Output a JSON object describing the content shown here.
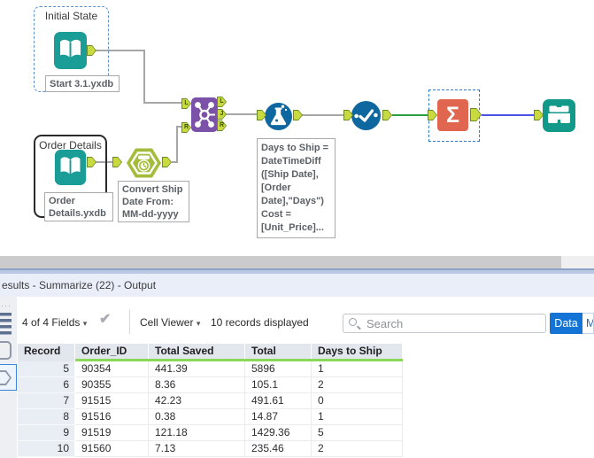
{
  "colors": {
    "input_teal": "#199d96",
    "browse_teal": "#12998a",
    "join_purple": "#7b52a8",
    "formula_blue": "#0e679e",
    "summarize_salmon": "#e06650",
    "anchor_green": "#c9da41",
    "wire_gray": "#a6a6a6",
    "wire_green": "#2f9e3f",
    "wire_blue": "#4d50e0",
    "data_tab_blue": "#1374d6",
    "header_underline_green": "#8bd757"
  },
  "canvas": {
    "initial_container": {
      "title": "Initial State",
      "tool_label": "Start 3.1.yxdb"
    },
    "order_container": {
      "title": "Order Details",
      "tool_label": "Order\nDetails.yxdb"
    },
    "datetime_annotation": "Convert Ship\nDate From:\nMM-dd-yyyy",
    "formula_annotation": "Days to Ship =\nDateTimeDiff\n([Ship Date],\n[Order\nDate],\"Days\")\nCost =\n[Unit_Price]...",
    "join_inputs": [
      "L",
      "R"
    ],
    "join_outputs": [
      "L",
      "J",
      "R"
    ],
    "summarize_sigma": "Σ"
  },
  "results": {
    "title": "esults - Summarize (22) - Output",
    "toolbar": {
      "fields_selector": "4 of 4 Fields",
      "dropdown_caret": "▾",
      "check_glyph": "✔",
      "cell_viewer": "Cell Viewer",
      "records_status": "10 records displayed",
      "search_placeholder": "Search",
      "data_tab": "Data",
      "metadata_tab": "M"
    },
    "table": {
      "columns": [
        "Record",
        "Order_ID",
        "Total Saved",
        "Total",
        "Days to Ship"
      ],
      "rows": [
        [
          "5",
          "90354",
          "441.39",
          "5896",
          "1"
        ],
        [
          "6",
          "90355",
          "8.36",
          "105.1",
          "2"
        ],
        [
          "7",
          "91515",
          "42.23",
          "491.61",
          "0"
        ],
        [
          "8",
          "91516",
          "0.38",
          "14.87",
          "1"
        ],
        [
          "9",
          "91519",
          "121.18",
          "1429.36",
          "5"
        ],
        [
          "10",
          "91560",
          "7.13",
          "235.46",
          "2"
        ]
      ]
    }
  }
}
